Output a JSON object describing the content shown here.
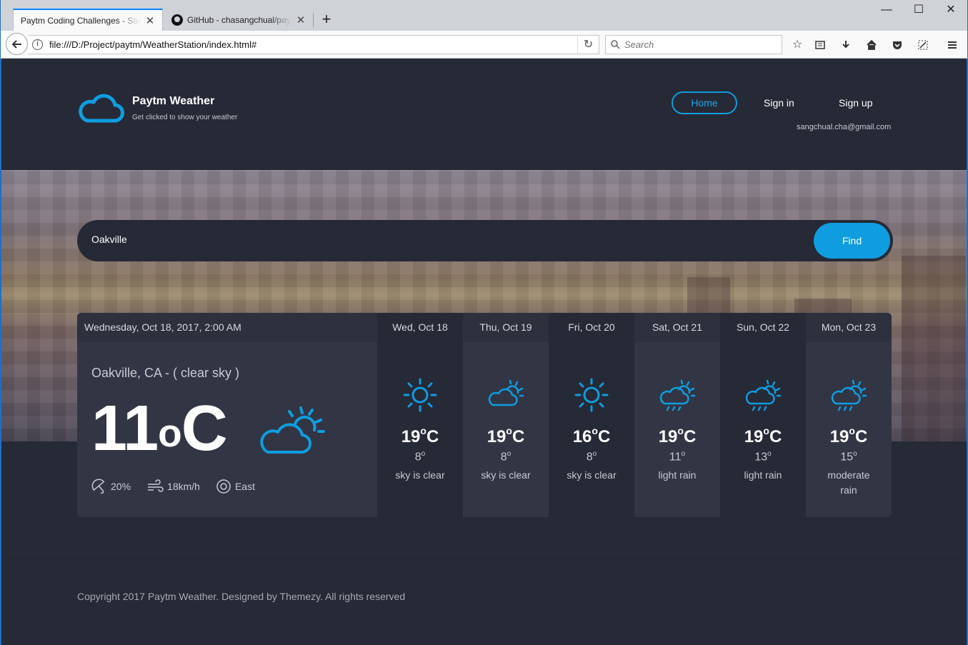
{
  "browser": {
    "tabs": [
      {
        "title": "Paytm Coding Challenges - Sang",
        "close": "✕"
      },
      {
        "title": "GitHub - chasangchual/paytm",
        "close": "✕"
      }
    ],
    "new_tab": "+",
    "window_controls": {
      "minimize": "—",
      "maximize": "☐",
      "close": "✕"
    },
    "url": "file:///D:/Project/paytm/WeatherStation/index.html#",
    "search_placeholder": "Search",
    "toolbar_icons": [
      "star-icon",
      "reading-list-icon",
      "download-icon",
      "home-icon",
      "pocket-icon",
      "screenshot-icon",
      "menu-icon"
    ]
  },
  "site": {
    "title": "Paytm Weather",
    "subtitle": "Get clicked to show your weather",
    "nav": {
      "home": "Home",
      "signin": "Sign in",
      "signup": "Sign up"
    },
    "user_email": "sangchual.cha@gmail.com"
  },
  "search": {
    "city": "Oakville",
    "button": "Find"
  },
  "today": {
    "datetime": "Wednesday, Oct 18, 2017, 2:00 AM",
    "location": "Oakville, CA - ( clear sky )",
    "temp": "11",
    "unit": "C",
    "degree": "o",
    "precipitation": "20%",
    "wind_speed": "18km/h",
    "wind_direction": "East"
  },
  "forecast": [
    {
      "label": "Wed, Oct 18",
      "high": "19",
      "low": "8",
      "desc": "sky is clear",
      "icon": "sun-icon"
    },
    {
      "label": "Thu, Oct 19",
      "high": "19",
      "low": "8",
      "desc": "sky is clear",
      "icon": "partly-cloudy-icon"
    },
    {
      "label": "Fri, Oct 20",
      "high": "16",
      "low": "8",
      "desc": "sky is clear",
      "icon": "sun-icon"
    },
    {
      "label": "Sat, Oct 21",
      "high": "19",
      "low": "11",
      "desc": "light rain",
      "icon": "rain-cloud-icon"
    },
    {
      "label": "Sun, Oct 22",
      "high": "19",
      "low": "13",
      "desc": "light rain",
      "icon": "rain-cloud-icon"
    },
    {
      "label": "Mon, Oct 23",
      "high": "19",
      "low": "15",
      "desc": "moderate rain",
      "icon": "rain-cloud-icon"
    }
  ],
  "footer": {
    "copyright": "Copyright 2017 Paytm Weather. Designed by Themezy. All rights reserved"
  },
  "colors": {
    "accent": "#0f9de0",
    "background": "#262936",
    "panel": "#323544"
  }
}
